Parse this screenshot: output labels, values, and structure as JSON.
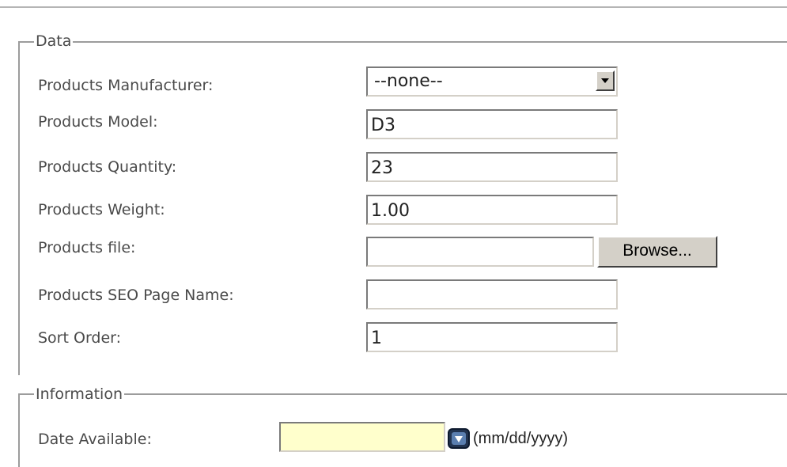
{
  "data_section": {
    "legend": "Data",
    "fields": {
      "manufacturer": {
        "label": "Products Manufacturer:",
        "value": "--none--"
      },
      "model": {
        "label": "Products Model:",
        "value": "D3"
      },
      "quantity": {
        "label": "Products Quantity:",
        "value": "23"
      },
      "weight": {
        "label": "Products Weight:",
        "value": "1.00"
      },
      "file": {
        "label": "Products file:",
        "value": "",
        "browse_label": "Browse..."
      },
      "seo_name": {
        "label": "Products SEO Page Name:",
        "value": ""
      },
      "sort_order": {
        "label": "Sort Order:",
        "value": "1"
      }
    }
  },
  "information_section": {
    "legend": "Information",
    "date_available": {
      "label": "Date Available:",
      "value": "",
      "format_hint": "(mm/dd/yyyy)",
      "icon": "calendar-icon",
      "background": "#ffffcc"
    }
  }
}
